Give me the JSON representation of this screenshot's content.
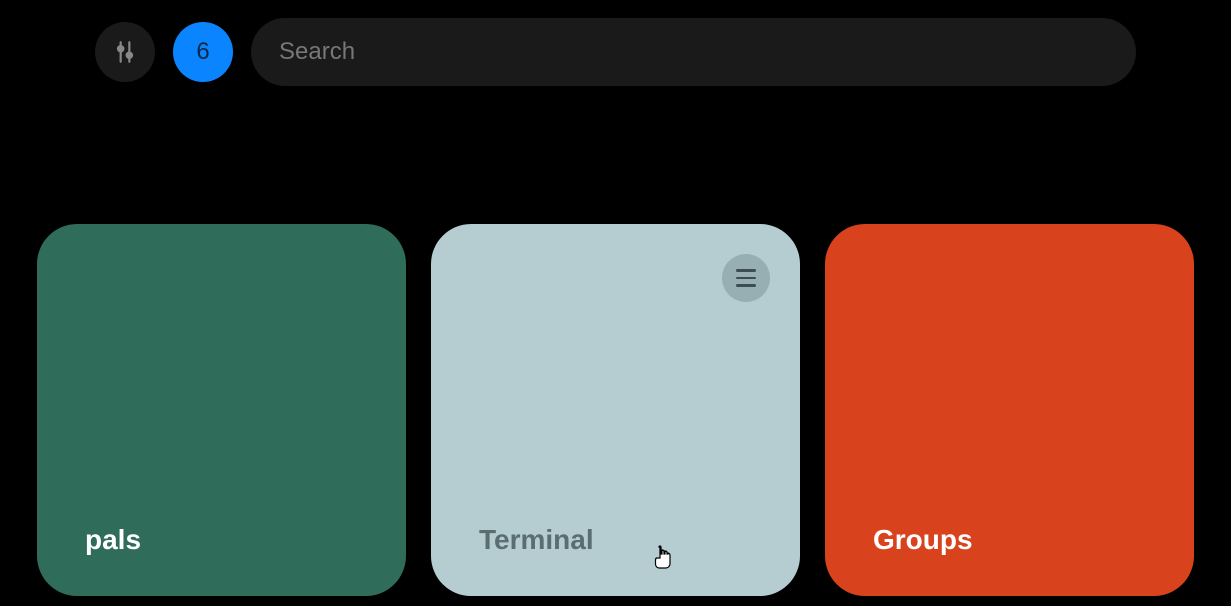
{
  "header": {
    "count": "6",
    "search_placeholder": "Search"
  },
  "cards": [
    {
      "label": "pals",
      "color": "#2f6c5a"
    },
    {
      "label": "Terminal",
      "color": "#b5ccd0"
    },
    {
      "label": "Groups",
      "color": "#d8431d"
    }
  ]
}
